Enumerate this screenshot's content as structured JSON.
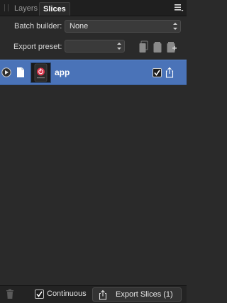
{
  "tabs": [
    {
      "label": "Layers",
      "active": false
    },
    {
      "label": "Slices",
      "active": true
    }
  ],
  "batch_builder": {
    "label": "Batch builder:",
    "value": "None"
  },
  "export_preset": {
    "label": "Export preset:",
    "value": ""
  },
  "slices": [
    {
      "name": "app",
      "selected": true,
      "checked": true
    }
  ],
  "footer": {
    "continuous_label": "Continuous",
    "continuous_checked": true,
    "export_label": "Export Slices (1)"
  },
  "icons": {
    "panel_menu": "hamburger-menu-icon",
    "preset_create": "new-preset-icon",
    "preset_copy": "copy-preset-icon",
    "preset_delete": "delete-preset-icon",
    "row_expand": "play-triangle-icon",
    "row_doc": "document-icon",
    "row_export": "export-share-icon",
    "trash": "trash-icon",
    "export_button": "export-share-icon"
  },
  "colors": {
    "panel_bg": "#2a2a2a",
    "selection": "#4a73b8",
    "tabbar_bg": "#1f1f1f"
  }
}
